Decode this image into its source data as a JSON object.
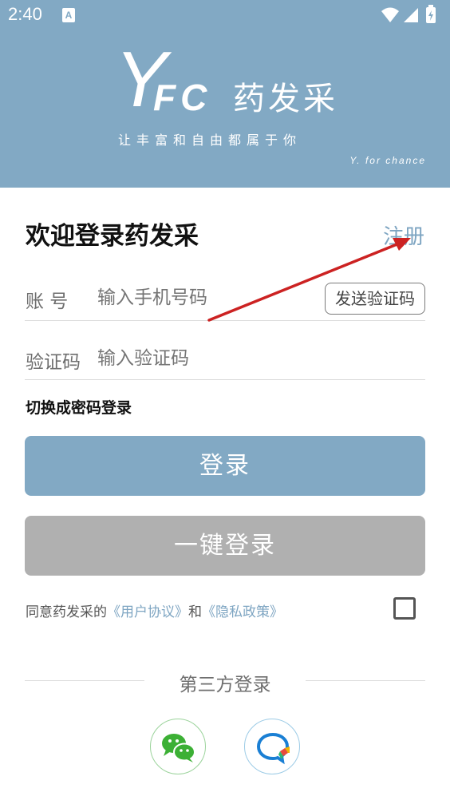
{
  "status_bar": {
    "time": "2:40",
    "notification_badge": "A"
  },
  "header": {
    "logo_y": "Y",
    "logo_fc": "FC",
    "logo_cn": "药发采",
    "slogan": "让丰富和自由都属于你",
    "subtitle": "Y. for chance",
    "background_color": "#82a9c4"
  },
  "login": {
    "title": "欢迎登录药发采",
    "register_label": "注册",
    "account_label": "账 号",
    "account_placeholder": "输入手机号码",
    "send_code_label": "发送验证码",
    "code_label": "验证码",
    "code_placeholder": "输入验证码",
    "switch_label": "切换成密码登录",
    "login_button": "登录",
    "onekey_button": "一键登录"
  },
  "agreement": {
    "prefix": "同意药发采的",
    "user_agreement": "《用户协议》",
    "and": "和",
    "privacy_policy": "《隐私政策》",
    "checked": false
  },
  "third_party": {
    "title": "第三方登录",
    "icons": [
      "wechat-icon",
      "chat-bubble-icon"
    ]
  },
  "colors": {
    "accent": "#82a9c4",
    "link": "#7ea5c2",
    "disabled_button": "#b0b0b0",
    "annotation_arrow": "#cc2222",
    "wechat_green": "#3cb035",
    "chat_blue": "#1a7fd4"
  }
}
